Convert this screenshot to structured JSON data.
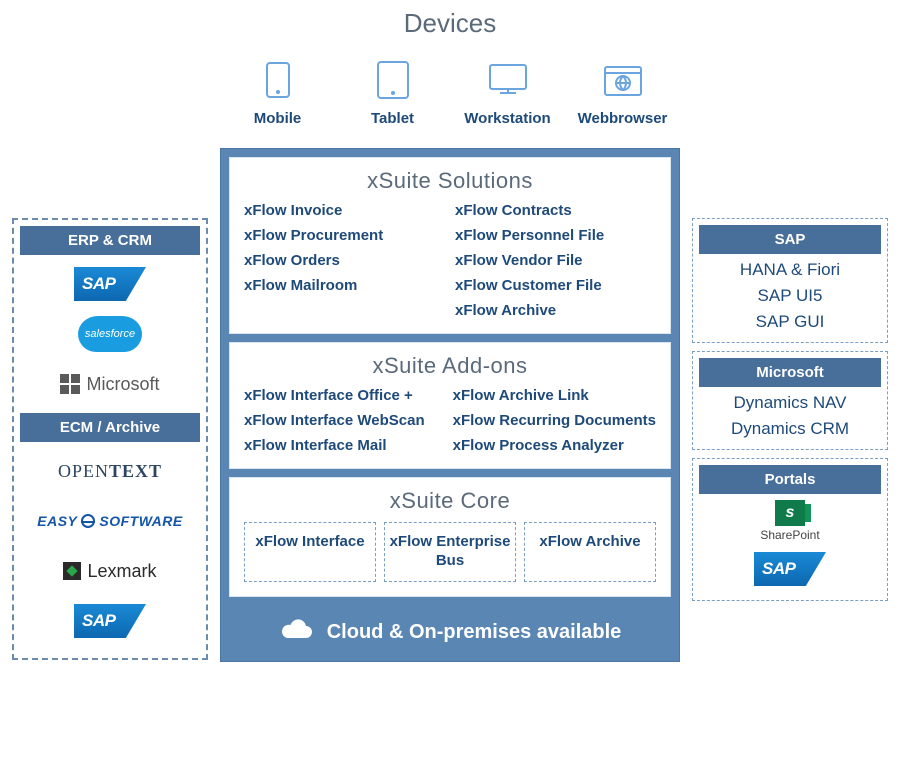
{
  "devices": {
    "title": "Devices",
    "items": [
      {
        "label": "Mobile"
      },
      {
        "label": "Tablet"
      },
      {
        "label": "Workstation"
      },
      {
        "label": "Webbrowser"
      }
    ]
  },
  "center": {
    "solutions": {
      "title": "xSuite Solutions",
      "col1": [
        "xFlow Invoice",
        "xFlow Procurement",
        "xFlow Orders",
        "xFlow Mailroom"
      ],
      "col2": [
        "xFlow Contracts",
        "xFlow Personnel File",
        "xFlow Vendor File",
        "xFlow Customer File",
        "xFlow Archive"
      ]
    },
    "addons": {
      "title": "xSuite Add-ons",
      "col1": [
        "xFlow Interface Office +",
        "xFlow Interface WebScan",
        "xFlow Interface Mail"
      ],
      "col2": [
        "xFlow Archive Link",
        "xFlow Recurring Documents",
        "xFlow Process Analyzer"
      ]
    },
    "core": {
      "title": "xSuite Core",
      "boxes": [
        "xFlow Interface",
        "xFlow Enterprise Bus",
        "xFlow Archive"
      ]
    },
    "cloud_bar": "Cloud & On-premises available"
  },
  "left": {
    "erp_crm": {
      "title": "ERP & CRM",
      "logos": [
        "SAP",
        "salesforce",
        "Microsoft"
      ]
    },
    "ecm_archive": {
      "title": "ECM / Archive",
      "logos": [
        "OPENTEXT",
        "EASY SOFTWARE",
        "Lexmark",
        "SAP"
      ]
    }
  },
  "right": {
    "sap": {
      "title": "SAP",
      "lines": [
        "HANA & Fiori",
        "SAP UI5",
        "SAP GUI"
      ]
    },
    "microsoft": {
      "title": "Microsoft",
      "lines": [
        "Dynamics NAV",
        "Dynamics CRM"
      ]
    },
    "portals": {
      "title": "Portals",
      "items": [
        "SharePoint",
        "SAP"
      ]
    }
  }
}
